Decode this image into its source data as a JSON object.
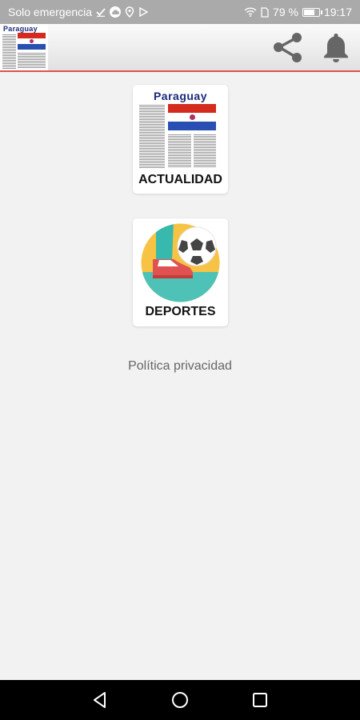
{
  "status_bar": {
    "carrier": "Solo emergencia",
    "battery": "79 %",
    "battery_level": 0.79,
    "time": "19:17",
    "icons": [
      "check-icon",
      "cloud-icon",
      "location-icon",
      "play-store-icon",
      "wifi-icon",
      "sim-icon",
      "battery-icon"
    ]
  },
  "header": {
    "logo_text": "Paraguay",
    "share_icon": "share-icon",
    "bell_icon": "bell-icon"
  },
  "tiles": [
    {
      "label": "ACTUALIDAD",
      "image_title": "Paraguay",
      "icon": "newspaper-paraguay-icon"
    },
    {
      "label": "DEPORTES",
      "icon": "football-icon"
    }
  ],
  "privacy_link": "Política privacidad",
  "nav": {
    "back": "back-icon",
    "home": "home-icon",
    "recents": "recents-icon"
  },
  "colors": {
    "status_bar": "#aaaaaa",
    "header_border": "#d9534f",
    "background": "#f2f2f2",
    "flag_red": "#d52b1e",
    "flag_blue": "#2a4fb3",
    "icon_gray": "#666666"
  }
}
